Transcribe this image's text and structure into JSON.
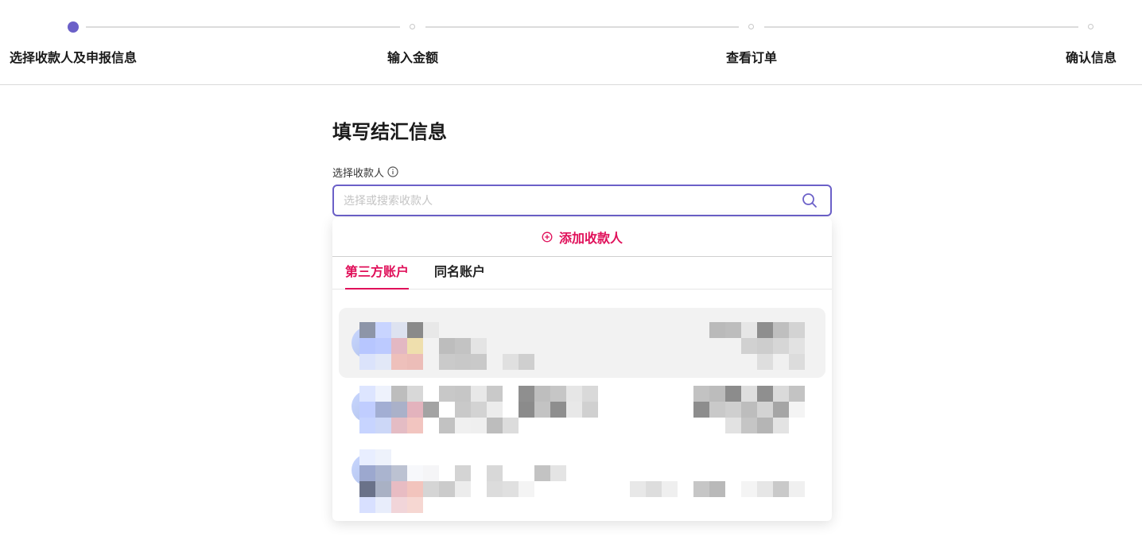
{
  "stepper": {
    "steps": [
      {
        "label": "选择收款人及申报信息",
        "active": true
      },
      {
        "label": "输入金额",
        "active": false
      },
      {
        "label": "查看订单",
        "active": false
      },
      {
        "label": "确认信息",
        "active": false
      }
    ]
  },
  "form": {
    "title": "填写结汇信息",
    "payee_label": "选择收款人",
    "search_placeholder": "选择或搜索收款人"
  },
  "dropdown": {
    "add_payee_label": "添加收款人",
    "tabs": [
      {
        "label": "第三方账户",
        "active": true
      },
      {
        "label": "同名账户",
        "active": false
      }
    ]
  },
  "colors": {
    "accent": "#6b60c8",
    "brand": "#e0105a"
  }
}
